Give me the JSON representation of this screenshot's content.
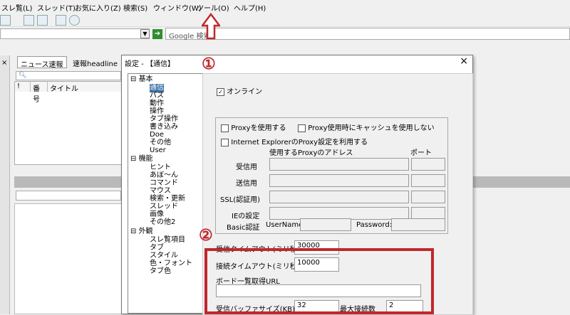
{
  "menu": [
    "スレ覧(L)",
    "スレッド(T)",
    "お気に入り(Z)",
    "検索(S)",
    "ウィンドウ(W)",
    "ツール(O)",
    "ヘルプ(H)"
  ],
  "search": {
    "placeholder": "Google 検索"
  },
  "tabs": [
    "ニュース速報",
    "速報headline"
  ],
  "thread_columns": [
    "!",
    "番号",
    "タイトル"
  ],
  "dialog": {
    "title": "設定 - 【通信】",
    "close": "×",
    "tree": {
      "groups": [
        {
          "label": "基本",
          "items": [
            "通信",
            "パス",
            "動作",
            "操作",
            "タブ操作",
            "書き込み",
            "Doe",
            "その他",
            "User"
          ]
        },
        {
          "label": "機能",
          "items": [
            "ヒント",
            "あぼ～ん",
            "コマンド",
            "マウス",
            "検索・更新",
            "スレッド",
            "画像",
            "その他2"
          ]
        },
        {
          "label": "外観",
          "items": [
            "スレ覧項目",
            "タブ",
            "スタイル",
            "色・フォント",
            "タブ色"
          ]
        }
      ],
      "selected": "通信"
    },
    "online": {
      "label": "オンライン",
      "checked": "✓"
    },
    "proxy": {
      "use_proxy": "Proxyを使用する",
      "no_cache": "Proxy使用時にキャッシュを使用しない",
      "use_ie": "Internet ExplorerのProxy設定を利用する",
      "col_address": "使用するProxyのアドレス",
      "col_port": "ポート",
      "rows": [
        "受信用",
        "送信用",
        "SSL(認証用)",
        "IEの設定"
      ],
      "basic_auth": "Basic認証",
      "username": "UserName:",
      "password": "Password:"
    },
    "recv_timeout": {
      "label": "受信タイムアウト(ミリ秒)",
      "value": "30000"
    },
    "conn_timeout": {
      "label": "接続タイムアウト(ミリ秒)",
      "value": "10000"
    },
    "board_url": {
      "label": "ボード一覧取得URL",
      "value": ""
    },
    "buffer": {
      "label": "受信バッファサイズ(KB)",
      "value": "32"
    },
    "max_conn": {
      "label": "最大接続数",
      "value": "2"
    }
  },
  "annotations": {
    "one": "①",
    "two": "②"
  },
  "colors": {
    "annotation": "#c0282c",
    "selection": "#3a6ea5"
  }
}
